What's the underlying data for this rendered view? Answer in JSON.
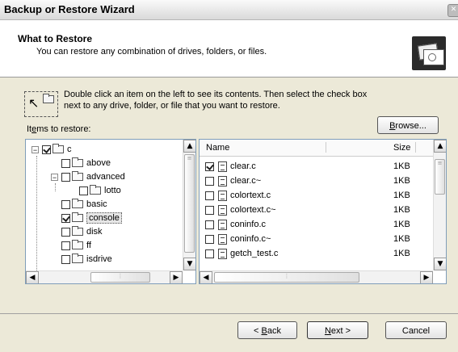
{
  "window": {
    "title": "Backup or Restore Wizard"
  },
  "header": {
    "title": "What to Restore",
    "subtitle": "You can restore any combination of drives, folders, or files."
  },
  "instructions": "Double click an item on the left to see its contents. Then select the check box next to any drive, folder, or file that you want to restore.",
  "items_label_accel": "e",
  "items_label_pre": "It",
  "items_label_post": "ms to restore:",
  "browse_button": {
    "accel": "B",
    "rest": "rowse..."
  },
  "tree": [
    {
      "label": "c",
      "checked": true,
      "expanded": true,
      "level": 0
    },
    {
      "label": "above",
      "checked": false,
      "level": 1
    },
    {
      "label": "advanced",
      "checked": false,
      "expanded": true,
      "level": 1
    },
    {
      "label": "lotto",
      "checked": false,
      "level": 2
    },
    {
      "label": "basic",
      "checked": false,
      "level": 1
    },
    {
      "label": "console",
      "checked": true,
      "selected": true,
      "level": 1
    },
    {
      "label": "disk",
      "checked": false,
      "level": 1
    },
    {
      "label": "ff",
      "checked": false,
      "level": 1
    },
    {
      "label": "isdrive",
      "checked": false,
      "level": 1
    }
  ],
  "file_list": {
    "col_name": "Name",
    "col_size": "Size",
    "rows": [
      {
        "name": "clear.c",
        "size": "1KB",
        "checked": true
      },
      {
        "name": "clear.c~",
        "size": "1KB",
        "checked": false
      },
      {
        "name": "colortext.c",
        "size": "1KB",
        "checked": false
      },
      {
        "name": "colortext.c~",
        "size": "1KB",
        "checked": false
      },
      {
        "name": "coninfo.c",
        "size": "1KB",
        "checked": false
      },
      {
        "name": "coninfo.c~",
        "size": "1KB",
        "checked": false
      },
      {
        "name": "getch_test.c",
        "size": "1KB",
        "checked": false
      }
    ]
  },
  "buttons": {
    "back_pre": "< ",
    "back_accel": "B",
    "back_post": "ack",
    "next_accel": "N",
    "next_post": "ext >",
    "cancel": "Cancel"
  }
}
